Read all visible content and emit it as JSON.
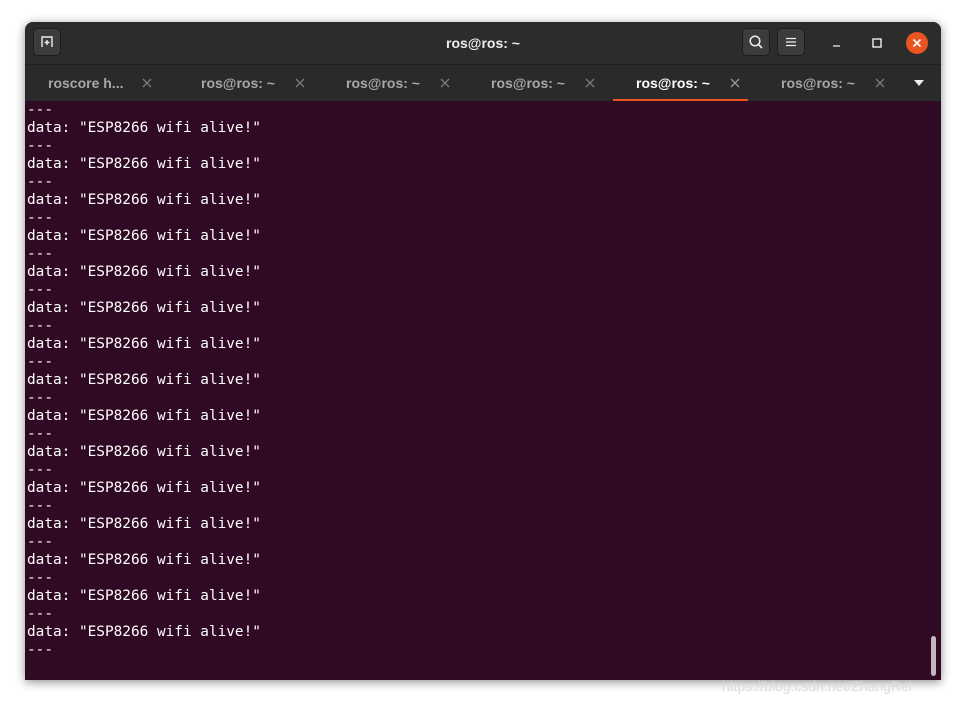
{
  "window": {
    "title": "ros@ros: ~"
  },
  "tabs": [
    {
      "label": "roscore h...",
      "active": false
    },
    {
      "label": "ros@ros: ~",
      "active": false
    },
    {
      "label": "ros@ros: ~",
      "active": false
    },
    {
      "label": "ros@ros: ~",
      "active": false
    },
    {
      "label": "ros@ros: ~",
      "active": true
    },
    {
      "label": "ros@ros: ~",
      "active": false
    }
  ],
  "terminal": {
    "lines": [
      "---",
      "data: \"ESP8266 wifi alive!\"",
      "---",
      "data: \"ESP8266 wifi alive!\"",
      "---",
      "data: \"ESP8266 wifi alive!\"",
      "---",
      "data: \"ESP8266 wifi alive!\"",
      "---",
      "data: \"ESP8266 wifi alive!\"",
      "---",
      "data: \"ESP8266 wifi alive!\"",
      "---",
      "data: \"ESP8266 wifi alive!\"",
      "---",
      "data: \"ESP8266 wifi alive!\"",
      "---",
      "data: \"ESP8266 wifi alive!\"",
      "---",
      "data: \"ESP8266 wifi alive!\"",
      "---",
      "data: \"ESP8266 wifi alive!\"",
      "---",
      "data: \"ESP8266 wifi alive!\"",
      "---",
      "data: \"ESP8266 wifi alive!\"",
      "---",
      "data: \"ESP8266 wifi alive!\"",
      "---",
      "data: \"ESP8266 wifi alive!\"",
      "---"
    ]
  },
  "watermark": "https://blog.csdn.net/ZhangRel",
  "icons": {
    "new_tab": "new-tab-icon",
    "search": "search-icon",
    "menu": "hamburger-menu-icon",
    "minimize": "minimize-icon",
    "maximize": "maximize-icon",
    "close": "close-icon",
    "tab_close": "tab-close-icon",
    "tab_list": "chevron-down-icon"
  },
  "colors": {
    "terminal_background": "#300a24",
    "accent": "#e95420",
    "titlebar": "#2c2c2c"
  }
}
